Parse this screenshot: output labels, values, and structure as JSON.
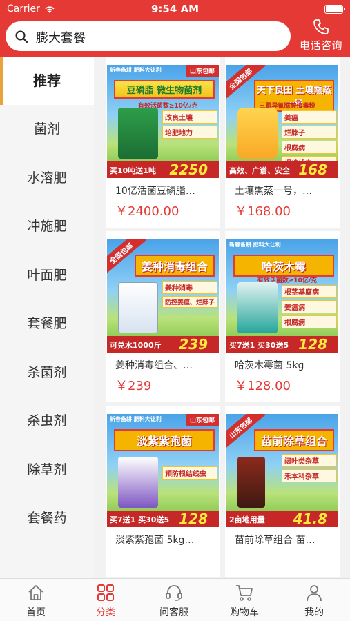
{
  "status_bar": {
    "carrier": "Carrier",
    "time": "9:54 AM"
  },
  "search": {
    "text": "膨大套餐"
  },
  "phone": {
    "label": "电话咨询"
  },
  "sidebar": {
    "items": [
      {
        "label": "推荐",
        "active": true
      },
      {
        "label": "菌剂"
      },
      {
        "label": "水溶肥"
      },
      {
        "label": "冲施肥"
      },
      {
        "label": "叶面肥"
      },
      {
        "label": "套餐肥"
      },
      {
        "label": "杀菌剂"
      },
      {
        "label": "杀虫剂"
      },
      {
        "label": "除草剂"
      },
      {
        "label": "套餐药"
      }
    ]
  },
  "products": [
    {
      "name": "10亿活菌豆磷脂…",
      "price": "￥2400.00",
      "image": {
        "title": "豆磷脂 微生物菌剂",
        "sub": "有效活菌数≥10亿/克",
        "bullets": [
          "改良土壤",
          "培肥地力"
        ],
        "top_strip": "新春备耕 肥料大让利",
        "corner": "山东包邮",
        "promo": "买10吨送1吨",
        "band_price": "2250"
      }
    },
    {
      "name": "土壤熏蒸一号，…",
      "price": "￥168.00",
      "image": {
        "ribbon": "全国包邮",
        "title": "天下良田 土壤熏蒸一号",
        "sub": "三氯异氰脲酸消毒粉",
        "bullets": [
          "姜瘟",
          "烂脖子",
          "根腐病",
          "根结线虫"
        ],
        "promo": "高效、广谱、安全",
        "band_price": "168"
      }
    },
    {
      "name": "姜种消毒组合、…",
      "price": "￥239",
      "image": {
        "ribbon": "全国包邮",
        "title": "姜种消毒组合",
        "bullets": [
          "姜种消毒",
          "防控姜瘟、烂脖子"
        ],
        "promo": "可兑水1000斤",
        "band_price": "239"
      }
    },
    {
      "name": "哈茨木霉菌 5kg",
      "price": "￥128.00",
      "image": {
        "top_strip": "新春备耕 肥料大让利",
        "title": "哈茨木霉",
        "sub": "有效活菌数≥10亿/克",
        "bullets": [
          "根茎基腐病",
          "姜瘟病",
          "根腐病"
        ],
        "promo": "买7送1 买30送5",
        "band_price": "128"
      }
    },
    {
      "name": "淡紫紫孢菌 5kg…",
      "price": "",
      "image": {
        "top_strip": "新春备耕 肥料大让利",
        "corner": "山东包邮",
        "title": "淡紫紫孢菌",
        "bullets": [
          "预防根结线虫"
        ],
        "promo": "买7送1 买30送5",
        "band_price": "128"
      }
    },
    {
      "name": "苗前除草组合 苗…",
      "price": "",
      "image": {
        "ribbon": "山东包邮",
        "title": "苗前除草组合",
        "bullets": [
          "阔叶类杂草",
          "禾本科杂草"
        ],
        "promo": "2亩地用量",
        "band_price": "41.8"
      }
    }
  ],
  "tabbar": {
    "items": [
      {
        "label": "首页"
      },
      {
        "label": "分类",
        "active": true
      },
      {
        "label": "问客服"
      },
      {
        "label": "购物车"
      },
      {
        "label": "我的"
      }
    ]
  },
  "colors": {
    "brand_red": "#e53935",
    "sidebar_accent": "#e8a33c"
  }
}
